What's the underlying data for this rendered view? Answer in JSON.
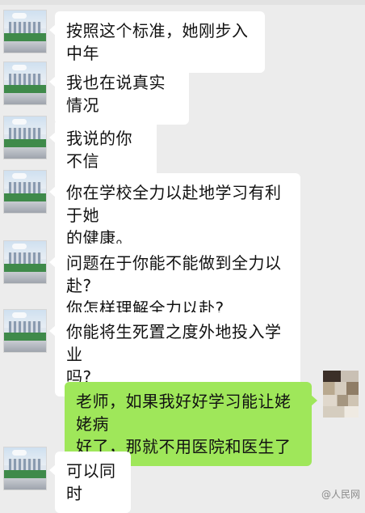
{
  "messages": [
    {
      "sender": "other",
      "text": "按照这个标准，她刚步入中年"
    },
    {
      "sender": "other",
      "text": "我也在说真实情况"
    },
    {
      "sender": "other",
      "text": "我说的你不信"
    },
    {
      "sender": "other",
      "text": "你在学校全力以赴地学习有利于她\n的健康。"
    },
    {
      "sender": "other",
      "text": "问题在于你能不能做到全力以赴?\n你怎样理解全力以赴?"
    },
    {
      "sender": "other",
      "text": "你能将生死置之度外地投入学业\n吗?"
    },
    {
      "sender": "me",
      "text": "老师，如果我好好学习能让姥姥病\n好了，那就不用医院和医生了"
    },
    {
      "sender": "other",
      "text": "可以同时"
    }
  ],
  "watermark": "@人民网"
}
